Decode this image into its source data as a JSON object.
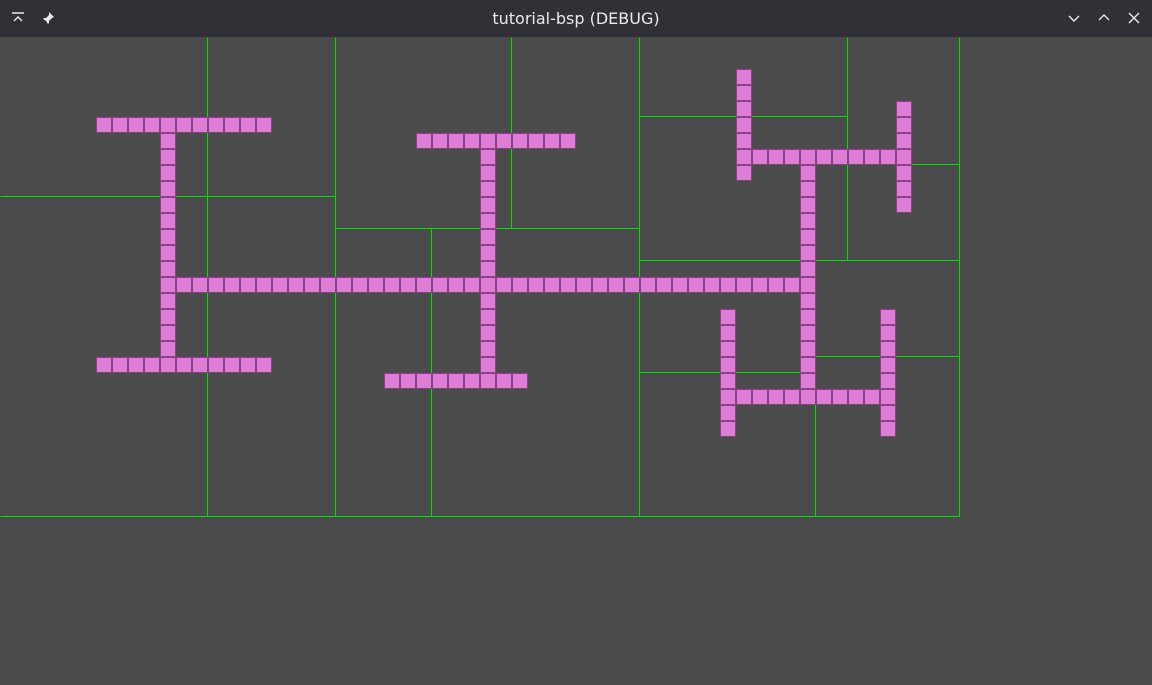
{
  "window": {
    "title": "tutorial-bsp (DEBUG)",
    "icons": {
      "left": [
        "keep-above-icon",
        "pin-icon"
      ],
      "right": [
        "minimize-icon",
        "maximize-icon",
        "close-icon"
      ]
    }
  },
  "scene": {
    "colors": {
      "background": "#4b4b4b",
      "partition_line": "#00e000",
      "tile_fill": "#de7dd6",
      "tile_border": "#8c3f86"
    }
  }
}
